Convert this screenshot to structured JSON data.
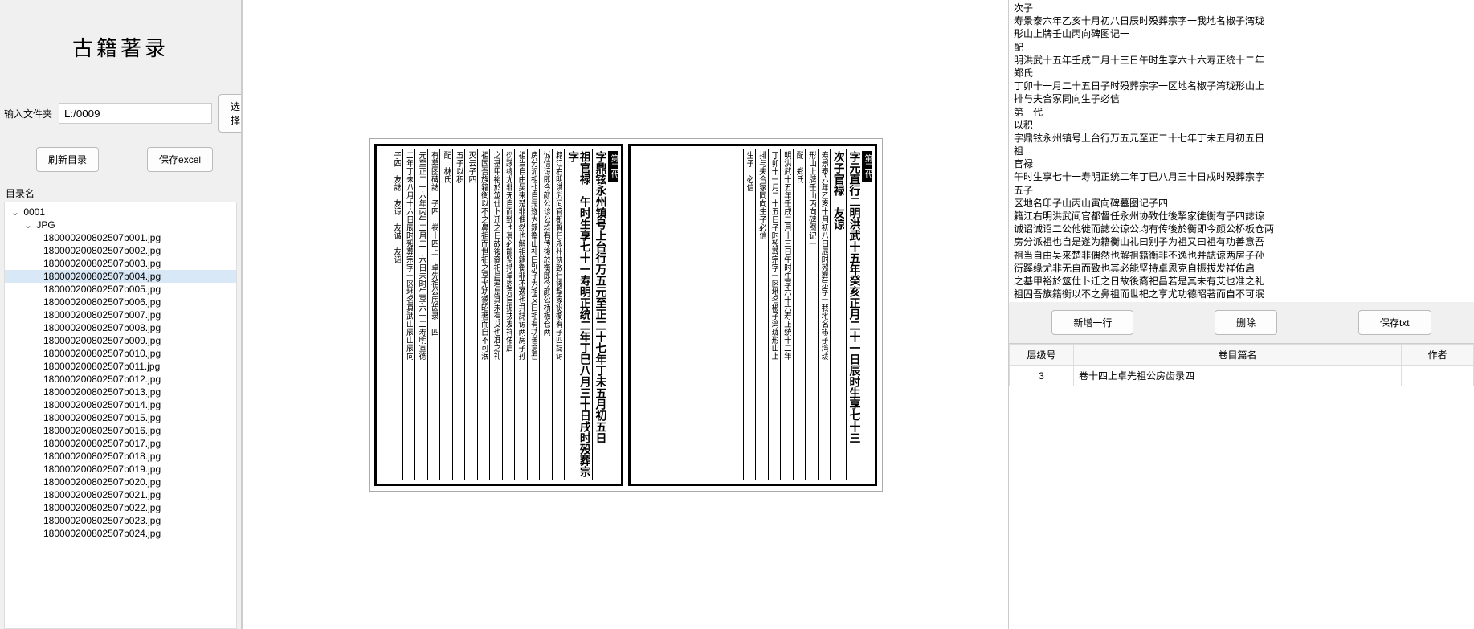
{
  "app_title": "古籍著录",
  "input_folder": {
    "label": "输入文件夹",
    "value": "L:/0009",
    "select_btn": "选择"
  },
  "left_buttons": {
    "refresh": "刷新目录",
    "save_excel": "保存excel"
  },
  "tree_header": "目录名",
  "tree": {
    "root": "0001",
    "sub": "JPG",
    "files": [
      "180000200802507b001.jpg",
      "180000200802507b002.jpg",
      "180000200802507b003.jpg",
      "180000200802507b004.jpg",
      "180000200802507b005.jpg",
      "180000200802507b006.jpg",
      "180000200802507b007.jpg",
      "180000200802507b008.jpg",
      "180000200802507b009.jpg",
      "180000200802507b010.jpg",
      "180000200802507b011.jpg",
      "180000200802507b012.jpg",
      "180000200802507b013.jpg",
      "180000200802507b014.jpg",
      "180000200802507b015.jpg",
      "180000200802507b016.jpg",
      "180000200802507b017.jpg",
      "180000200802507b018.jpg",
      "180000200802507b019.jpg",
      "180000200802507b020.jpg",
      "180000200802507b021.jpg",
      "180000200802507b022.jpg",
      "180000200802507b023.jpg",
      "180000200802507b024.jpg"
    ],
    "selected_index": 3
  },
  "doc": {
    "left_page": {
      "banner": "第二代",
      "cols": [
        "字鼎铉永州镇号上台行万五元至正二十七年丁未五月初五日",
        "祖官禄　午时生享七十一寿明正统二年丁巳八月三十日戌时殁葬宗字",
        "籍江右明洪武间官都督任永州协致仕後挈家徙衡有子四誌谅",
        "诚信谅即今颜公诊公均有传後於衡即今颜公桥板仓两",
        "房分派祖也自是遂为籍衡山礼曰别子为祖又曰祖有功善意吾",
        "祖当自由吴来楚非偶然也解祖籍衡非丕逸也并誌谅两房子孙",
        "衍蹊缘尤非无自而致也其必能坚持卓恩克自振拔发祥佑启",
        "之基甲裕於筮仕卜迁之日故後裔祀昌若是其未有艾也准之礼",
        "祖固吾族籍衡以不之鼻祖而世祀之享尤功德昭著而自不可泯",
        "灭云子四",
        "五子以积",
        "配　林氏",
        "有墓图碑誌　子四　卷十四上　卓先祖公房齿录　四",
        "元至正二十六年丙午二月二十六日未时生享六十二寿明宣德",
        "二年丁未八月十六日辰时殁葬宗字一区地名真武山辰山辰向",
        "子四　友誌　友谅　友诚　友诏"
      ]
    },
    "right_page": {
      "banner": "第二代",
      "cols": [
        "字元直行二明洪武十五年癸亥正月二十一日辰时生享七十三",
        "次子官禄　友谅",
        "寿景泰六年乙亥十月初八日辰时殁葬宗字一我地名椒子湾珑",
        "形山上牌壬山丙向碑图记一",
        "配　郑氏",
        "明洪武十五年壬戌二月十三日午时生享六十六寿正统十二年",
        "丁卯十一月二十五日子时殁葬宗字一区地名椒子湾珑形山上",
        "排与夫合冢同向生子必信",
        "生子　必信"
      ]
    }
  },
  "transcript": "次子\n寿景泰六年乙亥十月初八日辰时殁葬宗字一我地名椒子湾珑\n形山上牌壬山丙向碑图记一\n配\n明洪武十五年壬戌二月十三日午时生享六十六寿正统十二年\n郑氏\n丁卯十一月二十五日子时殁葬宗字一区地名椒子湾珑形山上\n排与夫合冢同向生子必信\n第一代\n以积\n字鼎铉永州镇号上台行万五元至正二十七年丁未五月初五日\n祖\n官禄\n午时生享七十一寿明正统二年丁巳八月三十日戌时殁葬宗字\n五子\n区地名印子山丙山寅向碑墓图记子四\n籍江右明洪武间官都督任永州协致仕後挈家徙衡有子四誌谅\n诚诏诚诏二公他徙而誌公谅公均有传後於衡即今颜公桥板仓两\n房分派祖也自是遂为籍衡山礼曰别子为祖又曰祖有功善意吾\n祖当自由吴来楚非偶然也解祖籍衡非丕逸也并誌谅两房子孙\n衍蹊缘尤非无自而致也其必能坚持卓恩克自振拔发祥佑启\n之基甲裕於筮仕卜迁之日故後裔祀昌若是其未有艾也准之礼\n祖固吾族籍衡以不之鼻祖而世祀之享尤功德昭著而自不可泯\n灭云子四\n配\n元至正二十六年丙午二月二十六日未时生享六十二寿明宣德\n林氏\n二年丁未八月十六日辰时殁葬宗字一区地名真武山辰山辰向\n有墓图碑誌子四友誌友谅友诚友诏\n卷十四上卓先祖公房齿录四",
  "right_buttons": {
    "add_row": "新增一行",
    "delete": "删除",
    "save_txt": "保存txt"
  },
  "grid": {
    "headers": [
      "层级号",
      "卷目篇名",
      "作者"
    ],
    "rows": [
      {
        "level": "3",
        "title": "卷十四上卓先祖公房齿录四",
        "author": ""
      }
    ]
  }
}
